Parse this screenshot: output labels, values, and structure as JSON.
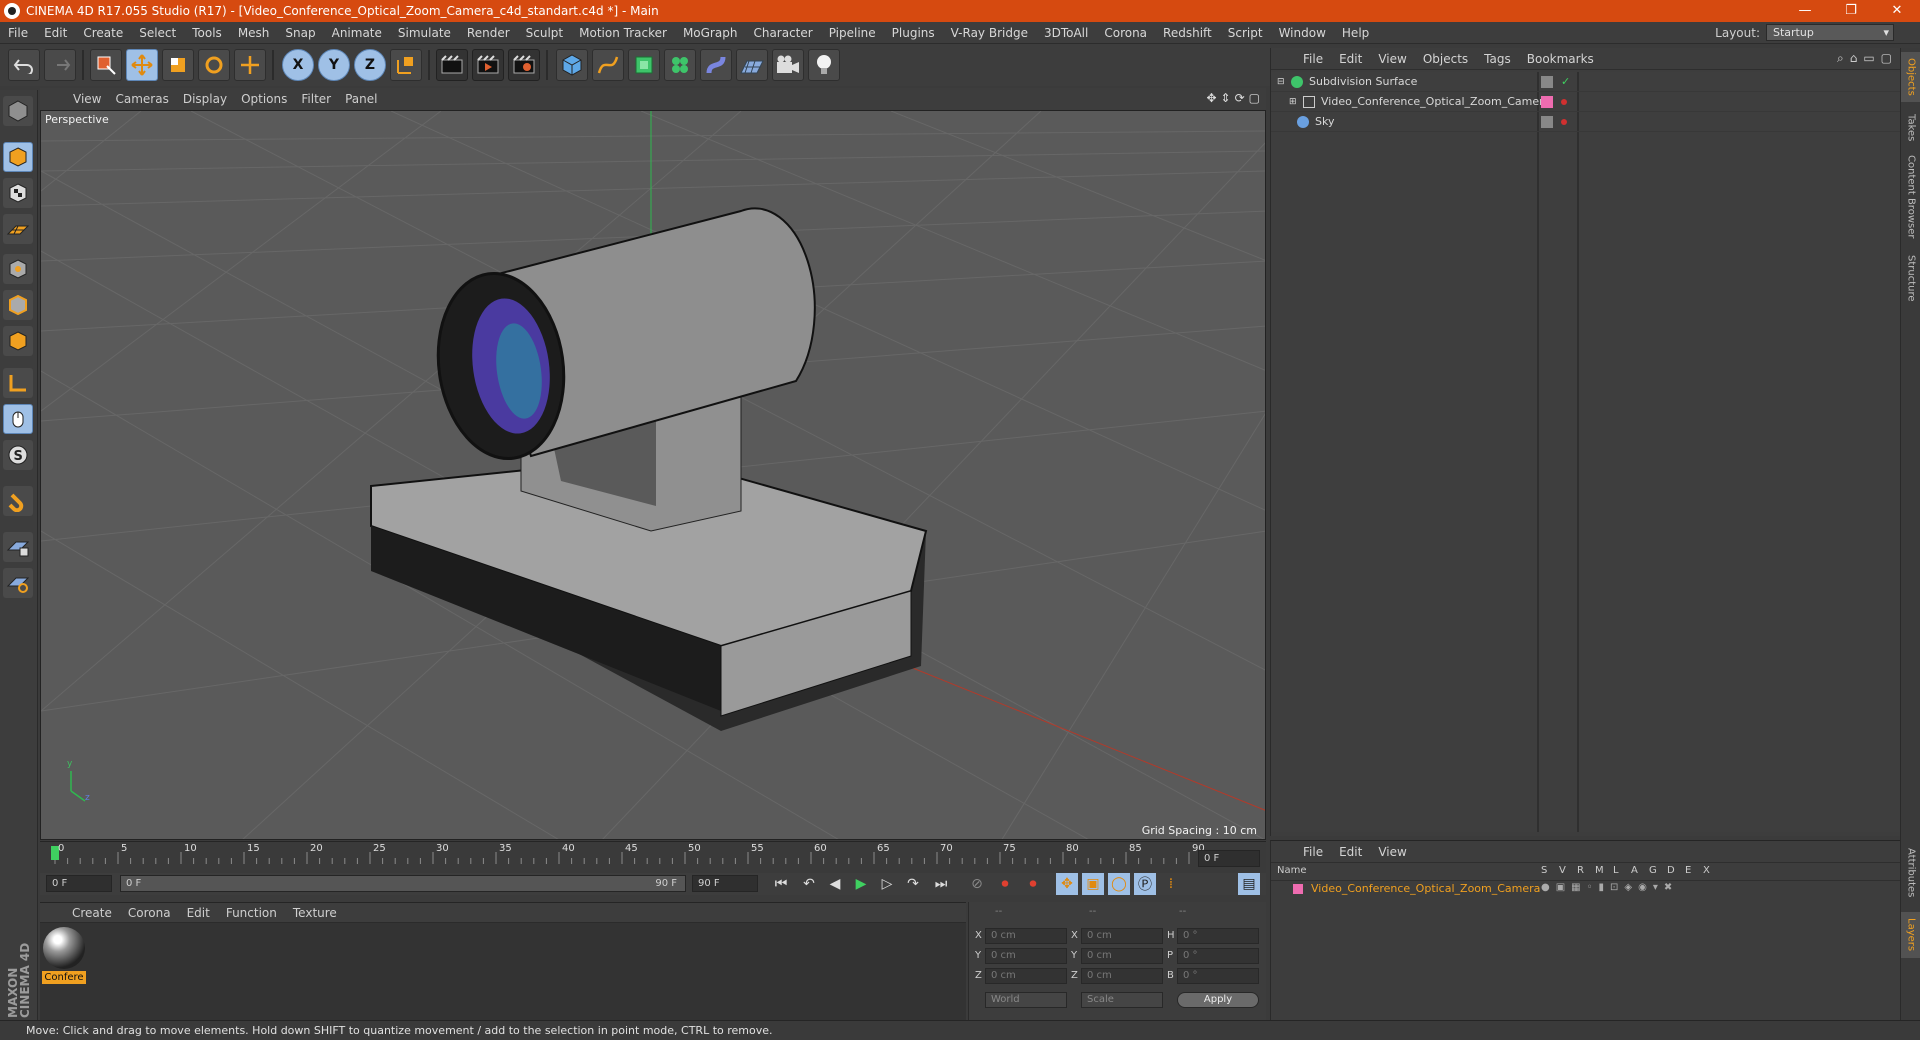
{
  "window": {
    "title": "CINEMA 4D R17.055 Studio (R17) - [Video_Conference_Optical_Zoom_Camera_c4d_standart.c4d *] - Main",
    "controls": [
      "—",
      "❐",
      "✕"
    ]
  },
  "menubar": {
    "items": [
      "File",
      "Edit",
      "Create",
      "Select",
      "Tools",
      "Mesh",
      "Snap",
      "Animate",
      "Simulate",
      "Render",
      "Sculpt",
      "Motion Tracker",
      "MoGraph",
      "Character",
      "Pipeline",
      "Plugins",
      "V-Ray Bridge",
      "3DToAll",
      "Corona",
      "Redshift",
      "Script",
      "Window",
      "Help"
    ],
    "layout_label": "Layout:",
    "layout_value": "Startup"
  },
  "toolbar": {
    "x_label": "X",
    "y_label": "Y",
    "z_label": "Z"
  },
  "viewport": {
    "menu": [
      "View",
      "Cameras",
      "Display",
      "Options",
      "Filter",
      "Panel"
    ],
    "label": "Perspective",
    "grid_spacing": "Grid Spacing : 10 cm",
    "axis_y": "y",
    "axis_z": "z",
    "colors": {
      "bg": "#5a5a5a",
      "grid": "#666666",
      "x_axis": "#c0392b",
      "y_axis": "#27ae60"
    }
  },
  "timeline": {
    "ticks": [
      "0",
      "5",
      "10",
      "15",
      "20",
      "25",
      "30",
      "35",
      "40",
      "45",
      "50",
      "55",
      "60",
      "65",
      "70",
      "75",
      "80",
      "85",
      "90"
    ],
    "end_frame": "0 F"
  },
  "transport": {
    "start": "0 F",
    "range_start": "0 F",
    "range_end": "90 F",
    "end": "90 F"
  },
  "material_manager": {
    "menu": [
      "Create",
      "Corona",
      "Edit",
      "Function",
      "Texture"
    ],
    "material_name": "Confere"
  },
  "coordinates": {
    "header": [
      "--",
      "--",
      "--"
    ],
    "rows": [
      {
        "a": "X",
        "av": "0 cm",
        "b": "X",
        "bv": "0 cm",
        "c": "H",
        "cv": "0 °"
      },
      {
        "a": "Y",
        "av": "0 cm",
        "b": "Y",
        "bv": "0 cm",
        "c": "P",
        "cv": "0 °"
      },
      {
        "a": "Z",
        "av": "0 cm",
        "b": "Z",
        "bv": "0 cm",
        "c": "B",
        "cv": "0 °"
      }
    ],
    "world": "World",
    "scale": "Scale",
    "apply": "Apply"
  },
  "object_manager": {
    "menu": [
      "File",
      "Edit",
      "View",
      "Objects",
      "Tags",
      "Bookmarks"
    ],
    "objects": [
      {
        "name": "Subdivision Surface"
      },
      {
        "name": "Video_Conference_Optical_Zoom_Camera"
      },
      {
        "name": "Sky"
      }
    ]
  },
  "layer_manager": {
    "menu": [
      "File",
      "Edit",
      "View"
    ],
    "name_header": "Name",
    "columns": [
      "S",
      "V",
      "R",
      "M",
      "L",
      "A",
      "G",
      "D",
      "E",
      "X"
    ],
    "layer_name": "Video_Conference_Optical_Zoom_Camera"
  },
  "side_tabs": [
    "Objects",
    "Takes",
    "Content Browser",
    "Structure",
    "Attributes",
    "Layers"
  ],
  "status": "Move: Click and drag to move elements. Hold down SHIFT to quantize movement / add to the selection in point mode, CTRL to remove.",
  "logo": "MAXON CINEMA 4D"
}
